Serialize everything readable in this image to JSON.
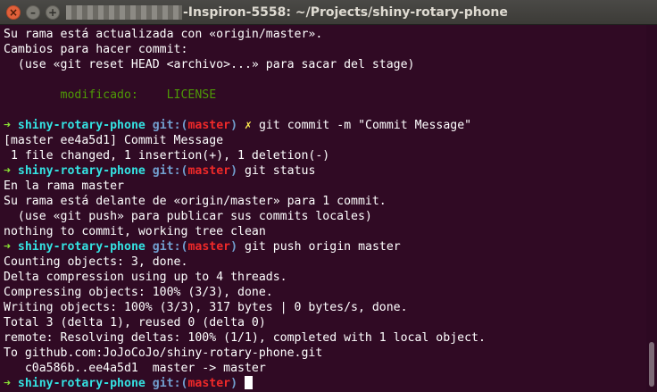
{
  "window": {
    "title": "-Inspiron-5558: ~/Projects/shiny-rotary-phone",
    "close_glyph": "×",
    "min_glyph": "–",
    "max_glyph": "+"
  },
  "prompt": {
    "arrow": "➜",
    "repo": "shiny-rotary-phone",
    "git_open": "git:(",
    "branch": "master",
    "git_close": ")",
    "dirty": "✗"
  },
  "output": {
    "l0": "Su rama está actualizada con «origin/master».",
    "l1": "Cambios para hacer commit:",
    "l2": "  (use «git reset HEAD <archivo>...» para sacar del stage)",
    "l4": "        modificado:    LICENSE",
    "cmd1": "git commit -m \"Commit Message\"",
    "l7": "[master ee4a5d1] Commit Message",
    "l8": " 1 file changed, 1 insertion(+), 1 deletion(-)",
    "cmd2": "git status",
    "l10": "En la rama master",
    "l11": "Su rama está delante de «origin/master» para 1 commit.",
    "l12": "  (use «git push» para publicar sus commits locales)",
    "l13": "nothing to commit, working tree clean",
    "cmd3": "git push origin master",
    "l15": "Counting objects: 3, done.",
    "l16": "Delta compression using up to 4 threads.",
    "l17": "Compressing objects: 100% (3/3), done.",
    "l18": "Writing objects: 100% (3/3), 317 bytes | 0 bytes/s, done.",
    "l19": "Total 3 (delta 1), reused 0 (delta 0)",
    "l20": "remote: Resolving deltas: 100% (1/1), completed with 1 local object.",
    "l21": "To github.com:JoJoCoJo/shiny-rotary-phone.git",
    "l22": "   c0a586b..ee4a5d1  master -> master"
  },
  "colors": {
    "background": "#300a24",
    "arrow": "#8ae234",
    "repo": "#34e2e2",
    "git_label": "#729fcf",
    "branch": "#ef2929",
    "dirty": "#fce94f",
    "modified": "#4e9a06"
  }
}
